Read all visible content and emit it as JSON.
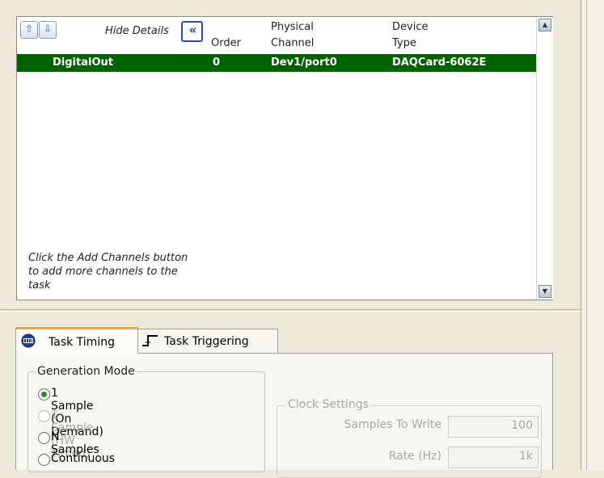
{
  "channel_table": {
    "hide_details_label": "Hide Details",
    "collapse_glyph": "«",
    "move_up_glyph": "⇧",
    "move_down_glyph": "⇩",
    "columns": {
      "order": "Order",
      "physical_channel_line1": "Physical",
      "physical_channel_line2": "Channel",
      "device_type_line1": "Device",
      "device_type_line2": "Type"
    },
    "rows": [
      {
        "name": "DigitalOut",
        "order": "0",
        "physical_channel": "Dev1/port0",
        "device_type": "DAQCard-6062E"
      }
    ],
    "hint_text": "Click the Add Channels button to add more channels to the task",
    "selected_row_color": "#006300"
  },
  "tabs": [
    {
      "label": "Task Timing",
      "icon": "clock-icon",
      "selected": true
    },
    {
      "label": "Task Triggering",
      "icon": "trigger-edge-icon",
      "selected": false
    }
  ],
  "generation_mode": {
    "legend": "Generation Mode",
    "options": [
      {
        "label": "1 Sample (On Demand)",
        "selected": true,
        "enabled": true
      },
      {
        "label": "1 Sample (HW Timed)",
        "selected": false,
        "enabled": false
      },
      {
        "label": "N Samples",
        "selected": false,
        "enabled": true
      },
      {
        "label": "Continuous",
        "selected": false,
        "enabled": true
      }
    ]
  },
  "clock_settings": {
    "legend": "Clock Settings",
    "samples_to_write_label": "Samples To Write",
    "samples_to_write_value": "100",
    "rate_label": "Rate (Hz)",
    "rate_value": "1k"
  }
}
